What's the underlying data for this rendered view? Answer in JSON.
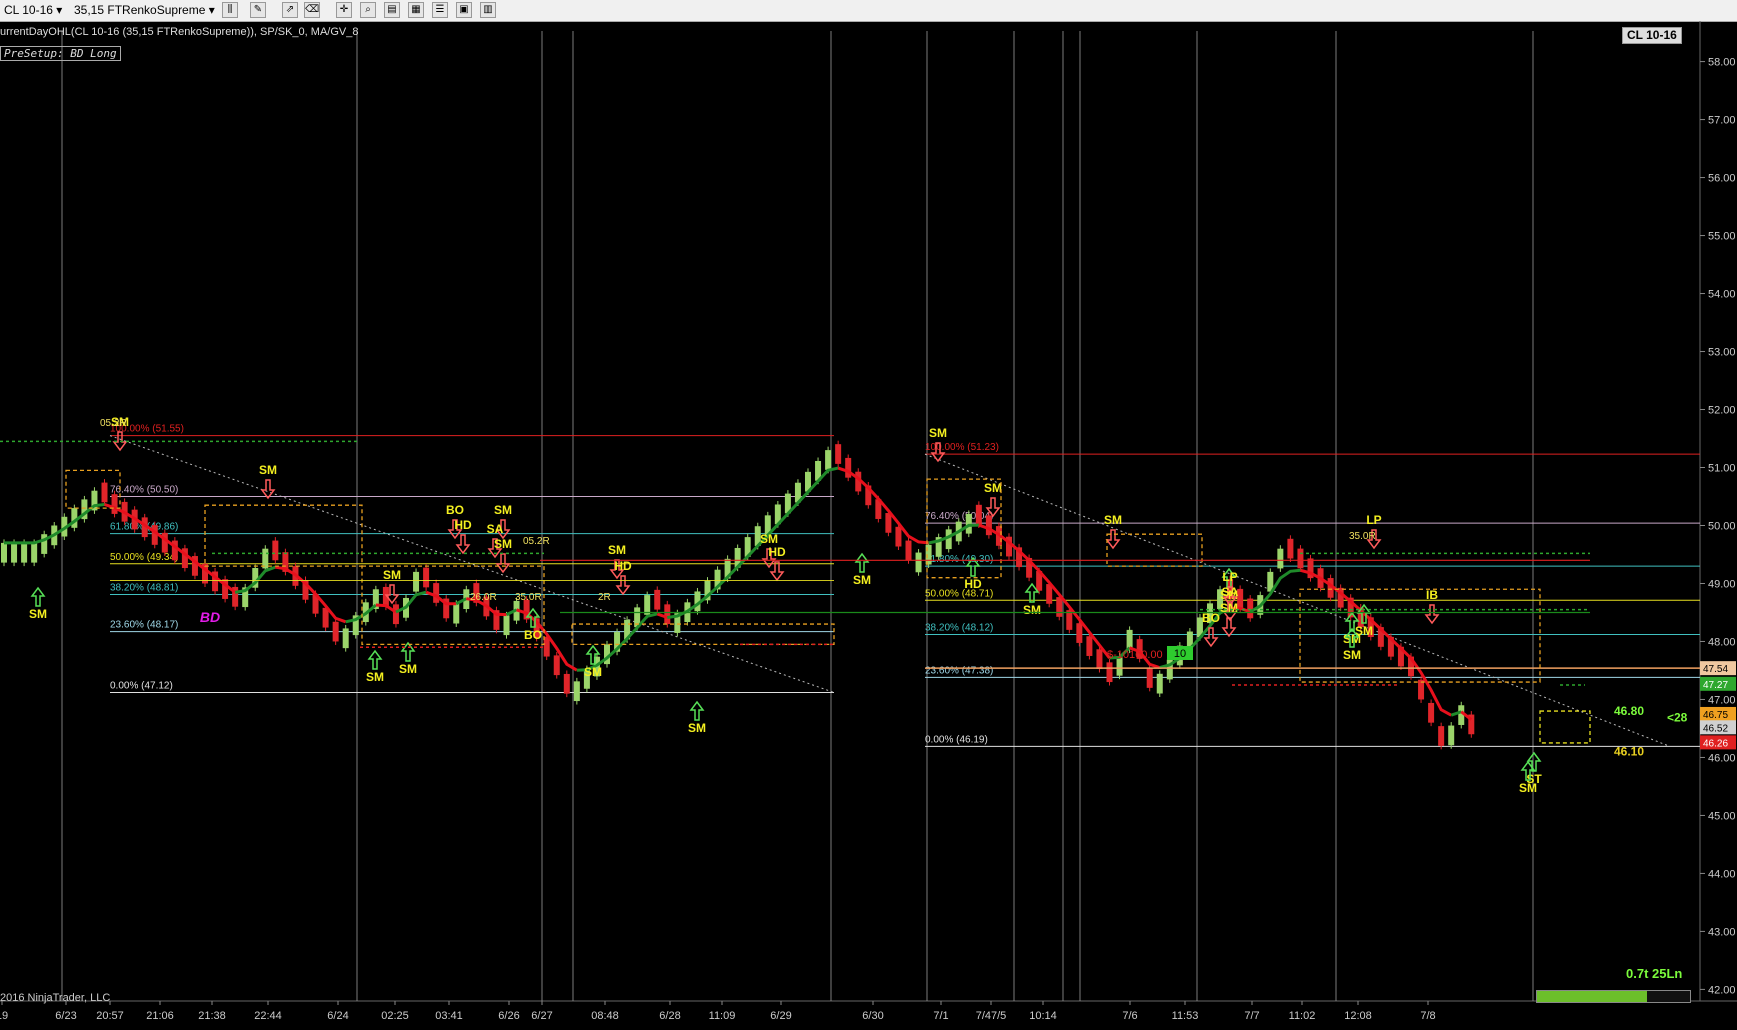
{
  "toolbar": {
    "instrument": "CL 10-16",
    "bar_type": "35,15 FTRenkoSupreme"
  },
  "instrument_tag": "CL 10-16",
  "indicator_label": "urrentDayOHL(CL 10-16 (35,15 FTRenkoSupreme)), SP/SK_0, MA/GV_8",
  "presetup": "PreSetup: BD Long",
  "copyright": "2016 NinjaTrader, LLC",
  "speed_label": "0.7t 25Ln",
  "progress_fraction": 0.72,
  "colors": {
    "background": "#000000",
    "up_bar": "#9bd46a",
    "down_bar": "#e0252a",
    "trail_red": "#e8101c",
    "trail_green": "#1f8a2a",
    "signal_yellow": "#f4f020",
    "bd_magenta": "#e21ce8"
  },
  "chart_data": {
    "type": "candlestick",
    "ylim": [
      41.8,
      58.7
    ],
    "y_ticks": [
      "58.00",
      "57.00",
      "56.00",
      "55.00",
      "54.00",
      "53.00",
      "52.00",
      "51.00",
      "50.00",
      "49.00",
      "48.00",
      "47.00",
      "46.00",
      "45.00",
      "44.00",
      "43.00",
      "42.00"
    ],
    "x_tick_labels": [
      "19",
      "6/23",
      "20:57",
      "21:06",
      "21:38",
      "22:44",
      "6/24",
      "02:25",
      "03:41",
      "6/26",
      "6/27",
      "08:48",
      "6/28",
      "11:09",
      "6/29",
      "6/30",
      "7/1",
      "7/47/5",
      "10:14",
      "7/6",
      "11:53",
      "7/7",
      "11:02",
      "12:08",
      "7/8"
    ],
    "session_separators": [
      "6/23",
      "6/24",
      "6/26",
      "6/27",
      "6/29",
      "6/30",
      "7/1",
      "7/4",
      "7/5",
      "7/6",
      "7/7",
      "7/8"
    ],
    "fib_sets": [
      {
        "levels": [
          {
            "label": "100.00% (51.55)",
            "price": 51.55,
            "color": "#e02020"
          },
          {
            "label": "76.40% (50.50)",
            "price": 50.5,
            "color": "#c8a8c8"
          },
          {
            "label": "61.80% (49.86)",
            "price": 49.86,
            "color": "#40c0c0"
          },
          {
            "label": "50.00% (49.34)",
            "price": 49.34,
            "color": "#e8e020"
          },
          {
            "label": "38.20% (48.81)",
            "price": 48.81,
            "color": "#40c0c0"
          },
          {
            "label": "23.60% (48.17)",
            "price": 48.17,
            "color": "#a0d8e8"
          },
          {
            "label": "0.00% (47.12)",
            "price": 47.12,
            "color": "#e0e0e0"
          }
        ]
      },
      {
        "levels": [
          {
            "label": "100.00% (51.23)",
            "price": 51.23,
            "color": "#e02020"
          },
          {
            "label": "76.40% (50.04)",
            "price": 50.04,
            "color": "#c8a8c8"
          },
          {
            "label": "61.80% (49.30)",
            "price": 49.3,
            "color": "#40c0c0"
          },
          {
            "label": "50.00% (48.71)",
            "price": 48.71,
            "color": "#e8e020"
          },
          {
            "label": "38.20% (48.12)",
            "price": 48.12,
            "color": "#40c0c0"
          },
          {
            "label": "23.60% (47.38)",
            "price": 47.38,
            "color": "#a0d8e8"
          },
          {
            "label": "0.00% (46.19)",
            "price": 46.19,
            "color": "#e0e0e0"
          }
        ]
      }
    ],
    "signals": [
      "SM",
      "SM",
      "SM",
      "BD",
      "SM",
      "SM",
      "SM",
      "BO",
      "HD",
      "SM",
      "SA",
      "SM",
      "BO",
      "SM",
      "SM",
      "HD",
      "SM",
      "SM",
      "HD",
      "SM",
      "SM",
      "SM",
      "SM",
      "HD",
      "SM",
      "SM",
      "SM",
      "LP",
      "SA",
      "SM",
      "BO",
      "SM",
      "SM",
      "LP",
      "IB",
      "ST",
      "SM",
      "SM",
      "BD"
    ],
    "range_labels": [
      "05.2R",
      "26.0R",
      "35.0R",
      "2R",
      "05.2R",
      "35.0R"
    ],
    "position_pnl": "$-10160.00",
    "position_qty": "10",
    "price_markers": [
      {
        "label": "47.54",
        "bg": "#f0c8a0",
        "fg": "#000"
      },
      {
        "label": "47.27",
        "bg": "#2ea82e",
        "fg": "#fff"
      },
      {
        "label": "46.75",
        "bg": "#f0a020",
        "fg": "#000"
      },
      {
        "label": "46.52",
        "bg": "#d0d0d0",
        "fg": "#000"
      },
      {
        "label": "46.26",
        "bg": "#e02020",
        "fg": "#fff"
      }
    ],
    "target_labels": [
      {
        "text": "46.80",
        "color": "#7cfc3c"
      },
      {
        "text": "46.10",
        "color": "#e8d020"
      },
      {
        "text": "<28",
        "color": "#7cfc3c"
      }
    ]
  }
}
